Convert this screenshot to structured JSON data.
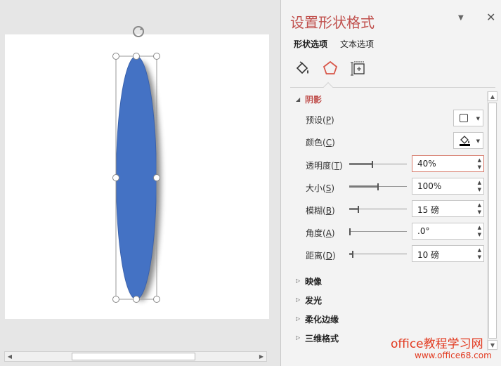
{
  "pane": {
    "title": "设置形状格式",
    "tabs": [
      {
        "label": "形状选项",
        "active": true
      },
      {
        "label": "文本选项",
        "active": false
      }
    ],
    "icons": [
      "fill-line-icon",
      "effects-pentagon-icon",
      "size-properties-icon"
    ]
  },
  "shadow": {
    "heading": "阴影",
    "rows": {
      "preset": {
        "label": "预设",
        "key": "P"
      },
      "color": {
        "label": "颜色",
        "key": "C"
      },
      "transparency": {
        "label": "透明度",
        "key": "T",
        "value": "40%",
        "slider": 0.4
      },
      "size": {
        "label": "大小",
        "key": "S",
        "value": "100%",
        "slider": 0.5
      },
      "blur": {
        "label": "模糊",
        "key": "B",
        "value": "15 磅",
        "slider": 0.15
      },
      "angle": {
        "label": "角度",
        "key": "A",
        "value": ".0°",
        "slider": 0.0
      },
      "distance": {
        "label": "距离",
        "key": "D",
        "value": "10 磅",
        "slider": 0.05
      }
    }
  },
  "sections": {
    "reflection": "映像",
    "glow": "发光",
    "soft_edges": "柔化边缘",
    "three_d_format": "三维格式"
  },
  "shape": {
    "fill_color": "#4472c4"
  },
  "colors": {
    "accent": "#c0504d"
  },
  "watermark": {
    "line1": "office教程学习网",
    "line2": "www.office68.com"
  }
}
